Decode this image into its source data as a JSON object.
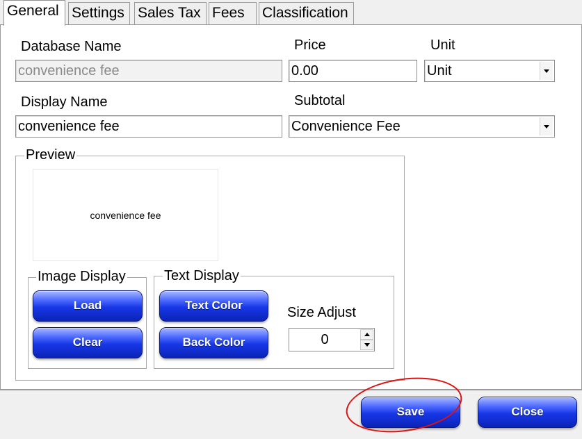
{
  "tabs": [
    {
      "label": "General",
      "active": true
    },
    {
      "label": "Settings",
      "active": false
    },
    {
      "label": "Sales Tax",
      "active": false
    },
    {
      "label": "Fees",
      "active": false
    },
    {
      "label": "Classification",
      "active": false
    }
  ],
  "form": {
    "database_name_label": "Database Name",
    "database_name_value": "convenience fee",
    "price_label": "Price",
    "price_value": "0.00",
    "unit_label": "Unit",
    "unit_value": "Unit",
    "display_name_label": "Display Name",
    "display_name_value": "convenience fee",
    "subtotal_label": "Subtotal",
    "subtotal_value": "Convenience Fee"
  },
  "preview": {
    "label": "Preview",
    "text": "convenience fee",
    "image_display": {
      "label": "Image Display",
      "load": "Load",
      "clear": "Clear"
    },
    "text_display": {
      "label": "Text Display",
      "text_color": "Text Color",
      "back_color": "Back Color"
    },
    "size_adjust": {
      "label": "Size Adjust",
      "value": "0"
    }
  },
  "footer": {
    "save": "Save",
    "close": "Close"
  },
  "colors": {
    "button_blue": "#1737e6",
    "annotation_red": "#dd1111"
  }
}
